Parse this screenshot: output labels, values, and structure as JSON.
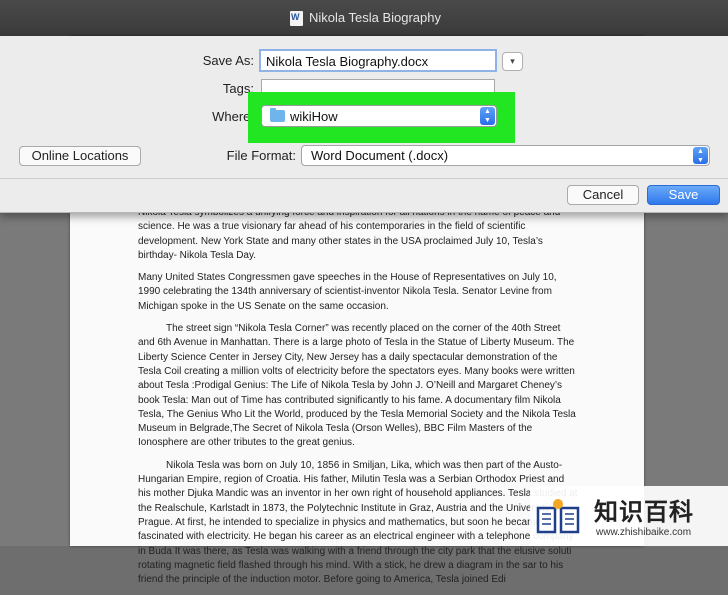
{
  "window": {
    "title": "Nikola Tesla Biography"
  },
  "dialog": {
    "save_as_label": "Save As:",
    "save_as_value": "Nikola Tesla Biography.docx",
    "tags_label": "Tags:",
    "where_label": "Where:",
    "where_value": "wikiHow",
    "online_locations_label": "Online Locations",
    "file_format_label": "File Format:",
    "file_format_value": "Word Document (.docx)",
    "cancel_label": "Cancel",
    "save_label": "Save"
  },
  "document": {
    "paragraphs": [
      "Nikola Tesla symbolizes a unifying force and inspiration for all nations in the name of peace and science. He was a true visionary far ahead of his contemporaries in the field of scientific development. New York State and many other states in the USA proclaimed July 10, Tesla’s birthday- Nikola Tesla Day.",
      "Many United States Congressmen gave speeches in the House of Representatives on July 10, 1990 celebrating the 134th anniversary of scientist-inventor Nikola Tesla. Senator Levine from Michigan spoke in the US Senate on the same occasion.",
      "The street sign “Nikola Tesla Corner” was recently placed on the corner of the 40th Street and 6th Avenue in Manhattan. There is a large photo of Tesla in the Statue of Liberty Museum. The Liberty Science Center in Jersey City, New Jersey has a daily spectacular demonstration of the Tesla Coil creating a million volts of electricity before the spectators eyes. Many books were written about Tesla :Prodigal Genius: The Life of Nikola Tesla by John J. O’Neill  and Margaret Cheney’s book Tesla: Man out of Time has contributed significantly to his fame. A documentary film Nikola Tesla, The Genius Who Lit the World, produced by the Tesla Memorial Society and the Nikola Tesla Museum in Belgrade,The Secret of Nikola Tesla (Orson Welles), BBC Film Masters of the Ionosphere are other tributes to the great genius.",
      "Nikola Tesla was born on July 10, 1856 in Smiljan, Lika, which was then part of  the Austo-Hungarian Empire, region of Croatia. His father, Milutin Tesla was a Serbian Orthodox Priest and his mother Djuka Mandic was an inventor in her own right of household appliances. Tesla studied at the Realschule, Karlstadt in 1873, the Polytechnic Institute in Graz, Austria and the University of Prague. At first, he intended to specialize in physics and mathematics, but soon he became fascinated with electricity. He began his career as an electrical engineer with a telephone company in Buda It was there, as Tesla was walking with a friend through the city park that the elusive soluti rotating magnetic field flashed through his mind. With a stick, he drew a diagram in the sar to his friend the principle of the induction motor. Before going to America, Tesla joined Edi"
    ]
  },
  "watermark": {
    "text": "知识百科",
    "url": "www.zhishibaike.com"
  }
}
